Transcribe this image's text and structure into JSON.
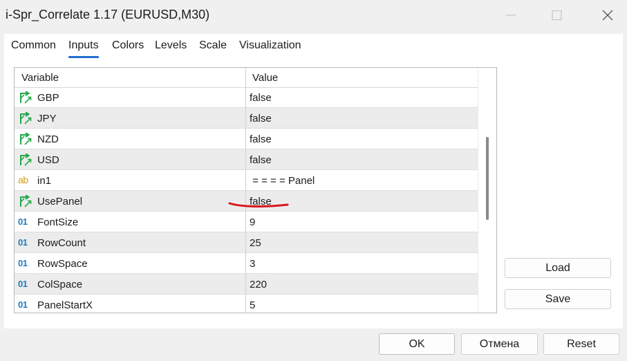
{
  "window": {
    "title": "i-Spr_Correlate 1.17 (EURUSD,M30)"
  },
  "tabs": [
    {
      "label": "Common"
    },
    {
      "label": "Inputs",
      "active": true
    },
    {
      "label": "Colors"
    },
    {
      "label": "Levels"
    },
    {
      "label": "Scale"
    },
    {
      "label": "Visualization"
    }
  ],
  "grid": {
    "headers": {
      "variable": "Variable",
      "value": "Value"
    },
    "rows": [
      {
        "icon": "bool-arrow-icon",
        "name": "GBP",
        "value": "false"
      },
      {
        "icon": "bool-arrow-icon",
        "name": "JPY",
        "value": "false"
      },
      {
        "icon": "bool-arrow-icon",
        "name": "NZD",
        "value": "false"
      },
      {
        "icon": "bool-arrow-icon",
        "name": "USD",
        "value": "false"
      },
      {
        "icon": "string-ab-icon",
        "icon_text": "ab",
        "name": "in1",
        "value": " = = = = Panel"
      },
      {
        "icon": "bool-arrow-icon",
        "name": "UsePanel",
        "value": "false"
      },
      {
        "icon": "integer-01-icon",
        "icon_text": "01",
        "name": "FontSize",
        "value": "9"
      },
      {
        "icon": "integer-01-icon",
        "icon_text": "01",
        "name": "RowCount",
        "value": "25"
      },
      {
        "icon": "integer-01-icon",
        "icon_text": "01",
        "name": "RowSpace",
        "value": "3"
      },
      {
        "icon": "integer-01-icon",
        "icon_text": "01",
        "name": "ColSpace",
        "value": "220"
      },
      {
        "icon": "integer-01-icon",
        "icon_text": "01",
        "name": "PanelStartX",
        "value": "5"
      }
    ]
  },
  "side_buttons": {
    "load": "Load",
    "save": "Save"
  },
  "footer_buttons": {
    "ok": "OK",
    "cancel": "Отмена",
    "reset": "Reset"
  },
  "colors": {
    "accent": "#1f6fd0",
    "bool_icon": "#22a84a",
    "string_icon": "#d39a19",
    "int_icon": "#1e7bbd",
    "annotation": "#d9141b"
  }
}
